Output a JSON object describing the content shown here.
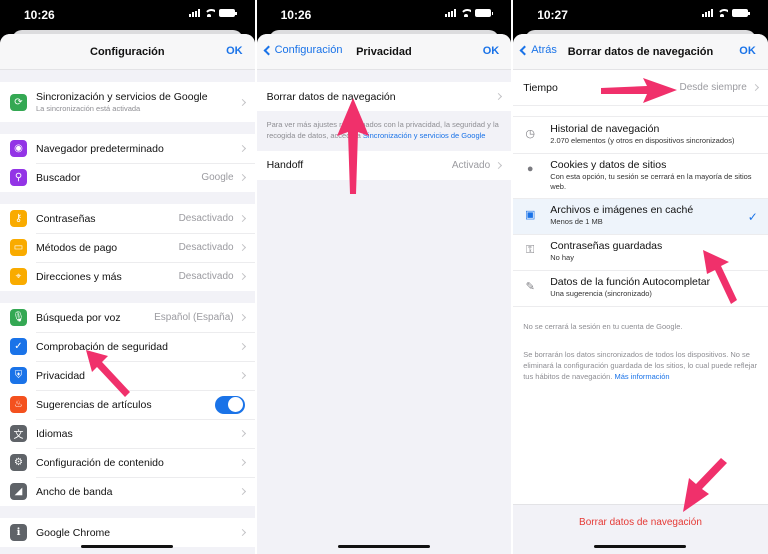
{
  "panels": [
    {
      "status_time": "10:26",
      "nav": {
        "title": "Configuración",
        "ok": "OK"
      },
      "groups": [
        [
          {
            "icon": "sync-icon",
            "icon_color": "#34a853",
            "label": "Sincronización y servicios de Google",
            "sub": "La sincronización está activada",
            "value": ""
          }
        ],
        [
          {
            "icon": "globe-icon",
            "icon_color": "#9334e6",
            "label": "Navegador predeterminado",
            "value": ""
          },
          {
            "icon": "search-icon",
            "icon_color": "#9334e6",
            "label": "Buscador",
            "value": "Google"
          }
        ],
        [
          {
            "icon": "key-icon",
            "icon_color": "#f9ab00",
            "label": "Contraseñas",
            "value": "Desactivado"
          },
          {
            "icon": "card-icon",
            "icon_color": "#f9ab00",
            "label": "Métodos de pago",
            "value": "Desactivado"
          },
          {
            "icon": "location-icon",
            "icon_color": "#f9ab00",
            "label": "Direcciones y más",
            "value": "Desactivado"
          }
        ],
        [
          {
            "icon": "mic-icon",
            "icon_color": "#34a853",
            "label": "Búsqueda por voz",
            "value": "Español (España)"
          },
          {
            "icon": "shield-check-icon",
            "icon_color": "#1a73e8",
            "label": "Comprobación de seguridad",
            "value": ""
          },
          {
            "icon": "shield-privacy-icon",
            "icon_color": "#1a73e8",
            "label": "Privacidad",
            "value": ""
          },
          {
            "icon": "flame-icon",
            "icon_color": "#f4511e",
            "label": "Sugerencias de artículos",
            "value": "",
            "toggle": true,
            "toggle_on": true
          },
          {
            "icon": "translate-icon",
            "icon_color": "#5f6368",
            "label": "Idiomas",
            "value": ""
          },
          {
            "icon": "gear-icon",
            "icon_color": "#5f6368",
            "label": "Configuración de contenido",
            "value": ""
          },
          {
            "icon": "bandwidth-icon",
            "icon_color": "#5f6368",
            "label": "Ancho de banda",
            "value": ""
          }
        ],
        [
          {
            "icon": "info-icon",
            "icon_color": "#5f6368",
            "label": "Google Chrome",
            "value": ""
          }
        ]
      ]
    },
    {
      "status_time": "10:26",
      "nav": {
        "back": "Configuración",
        "title": "Privacidad",
        "ok": "OK"
      },
      "clear_row": "Borrar datos de navegación",
      "footnote_text": "Para ver más ajustes relacionados con la privacidad, la seguridad y la recogida de datos, accede a ",
      "footnote_link": "Sincronización y servicios de Google",
      "handoff": {
        "label": "Handoff",
        "value": "Activado"
      }
    },
    {
      "status_time": "10:27",
      "nav": {
        "back": "Atrás",
        "title": "Borrar datos de navegación",
        "ok": "OK"
      },
      "time_row": {
        "label": "Tiempo",
        "value": "Desde siempre"
      },
      "items": [
        {
          "icon": "history-icon",
          "glyph": "◷",
          "label": "Historial de navegación",
          "sub": "2.070 elementos (y otros en dispositivos sincronizados)",
          "selected": false
        },
        {
          "icon": "cookie-icon",
          "glyph": "●",
          "label": "Cookies y datos de sitios",
          "sub": "Con esta opción, tu sesión se cerrará en la mayoría de sitios web.",
          "selected": false
        },
        {
          "icon": "cache-image-icon",
          "glyph": "▣",
          "label": "Archivos e imágenes en caché",
          "sub": "Menos de 1 MB",
          "selected": true
        },
        {
          "icon": "key-icon",
          "glyph": "⚿",
          "label": "Contraseñas guardadas",
          "sub": "No hay",
          "selected": false
        },
        {
          "icon": "autofill-wand-icon",
          "glyph": "✎",
          "label": "Datos de la función Autocompletar",
          "sub": "Una sugerencia (sincronizado)",
          "selected": false
        }
      ],
      "info1": "No se cerrará la sesión en tu cuenta de Google.",
      "info2": "Se borrarán los datos sincronizados de todos los dispositivos. No se eliminará la configuración guardada de los sitios, lo cual puede reflejar tus hábitos de navegación. ",
      "info2_link": "Más información",
      "clear_button": "Borrar datos de navegación"
    }
  ],
  "colors": {
    "accent": "#1a73e8",
    "annotation_arrow": "#f0306b",
    "destructive": "#e53935"
  }
}
